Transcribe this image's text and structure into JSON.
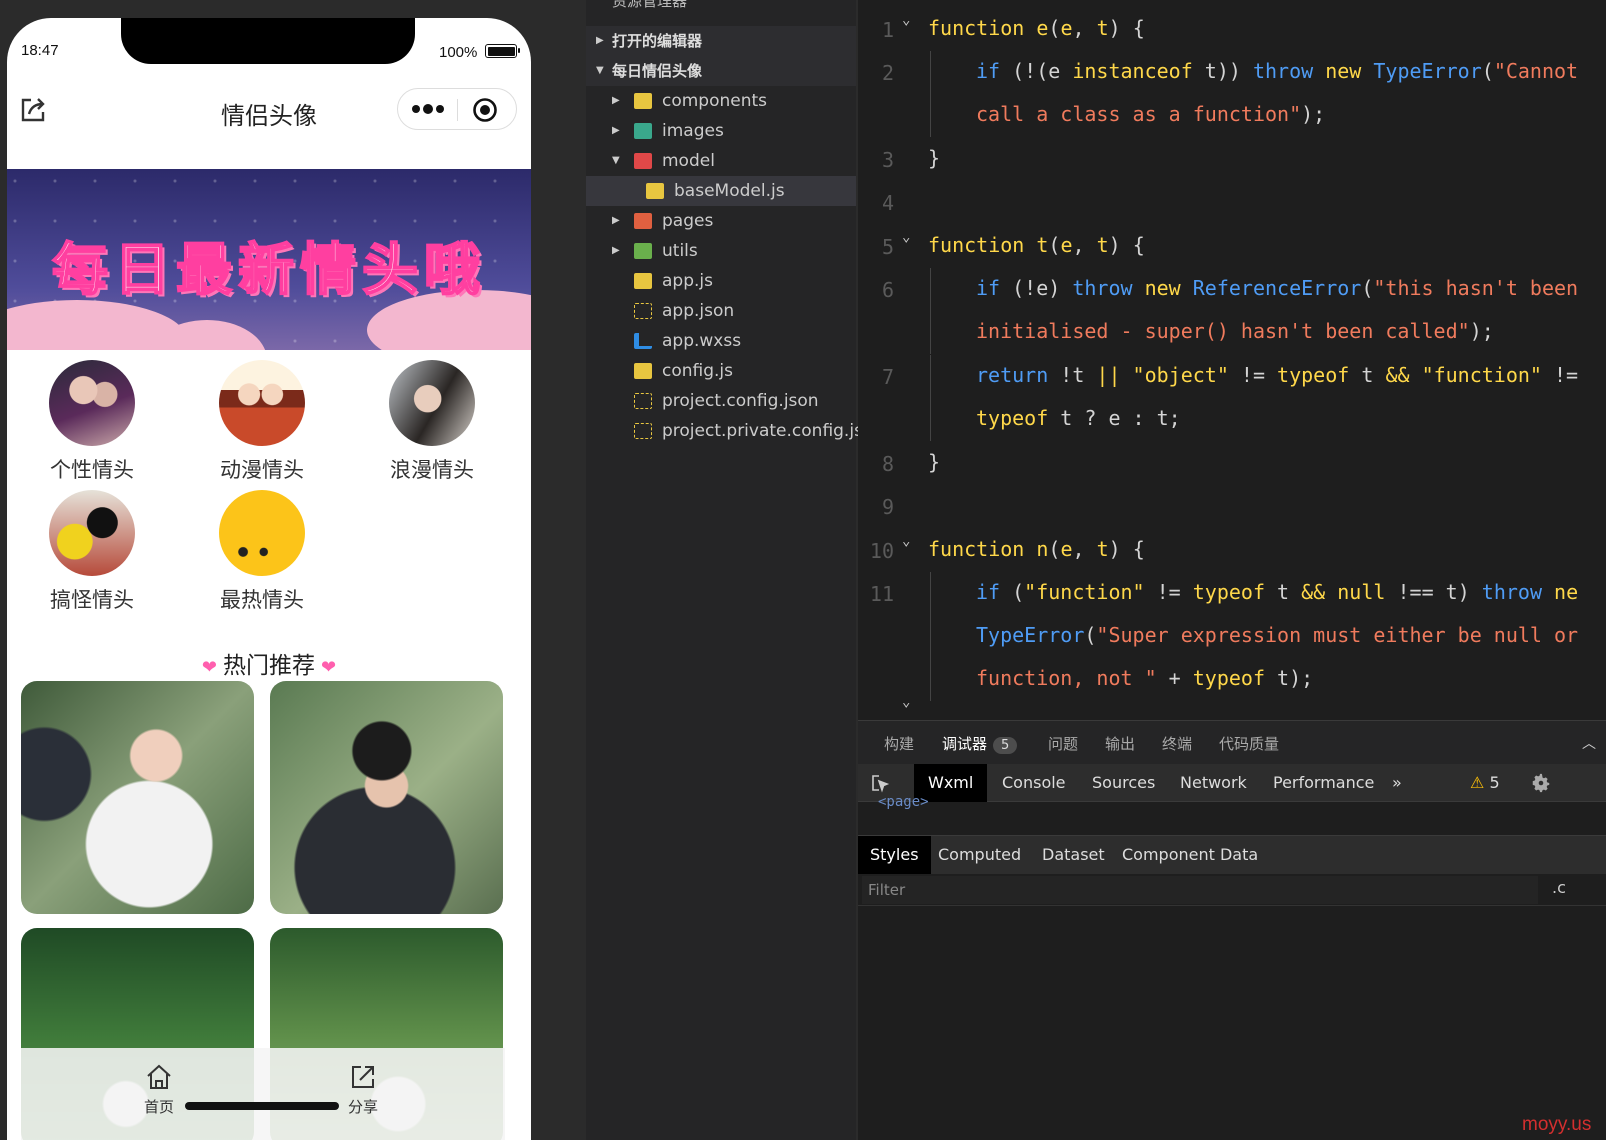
{
  "phone": {
    "status": {
      "time": "18:47",
      "battery": "100%",
      "battery_level": 1.0
    },
    "nav": {
      "title": "情侣头像"
    },
    "banner": {
      "text": "每日最新情头哦"
    },
    "categories": [
      {
        "label": "个性情头",
        "icon": "avatar-image"
      },
      {
        "label": "动漫情头",
        "icon": "avatar-image"
      },
      {
        "label": "浪漫情头",
        "icon": "avatar-image"
      },
      {
        "label": "搞怪情头",
        "icon": "avatar-image"
      },
      {
        "label": "最热情头",
        "icon": "avatar-image"
      }
    ],
    "hot_title": "热门推荐",
    "tabbar": [
      {
        "label": "首页",
        "icon": "home-icon"
      },
      {
        "label": "分享",
        "icon": "share-icon"
      }
    ]
  },
  "explorer": {
    "title": "资源管理器",
    "more": "···",
    "open_editors": "打开的编辑器",
    "project": "每日情侣头像",
    "items": [
      {
        "name": "components",
        "type": "folder",
        "color": "#e8c640"
      },
      {
        "name": "images",
        "type": "folder",
        "color": "#3aa88c"
      },
      {
        "name": "model",
        "type": "folder",
        "color": "#e04848"
      },
      {
        "name": "baseModel.js",
        "type": "js",
        "color": "#e8c640"
      },
      {
        "name": "pages",
        "type": "folder",
        "color": "#e06040"
      },
      {
        "name": "utils",
        "type": "folder",
        "color": "#6ab04c"
      },
      {
        "name": "app.js",
        "type": "js",
        "color": "#e8c640"
      },
      {
        "name": "app.json",
        "type": "json",
        "color": "#e8c640"
      },
      {
        "name": "app.wxss",
        "type": "css",
        "color": "#2f8de4"
      },
      {
        "name": "config.js",
        "type": "js",
        "color": "#e8c640"
      },
      {
        "name": "project.config.json",
        "type": "json",
        "color": "#e8c640"
      },
      {
        "name": "project.private.config.js...",
        "type": "json",
        "color": "#e8c640"
      }
    ]
  },
  "editor": {
    "lines": [
      {
        "n": "1",
        "fold": true,
        "indent": 0,
        "segs": [
          [
            "f",
            "function "
          ],
          [
            "y",
            "e"
          ],
          [
            "d",
            "("
          ],
          [
            "f",
            "e"
          ],
          [
            "d",
            ", "
          ],
          [
            "f",
            "t"
          ],
          [
            "d",
            ") {"
          ]
        ]
      },
      {
        "n": "2",
        "indent": 1,
        "segs": [
          [
            "k",
            "if "
          ],
          [
            "d",
            "(!("
          ],
          [
            "d",
            "e "
          ],
          [
            "f",
            "instanceof "
          ],
          [
            "d",
            "t)) "
          ],
          [
            "k",
            "throw "
          ],
          [
            "f",
            "new "
          ],
          [
            "k",
            "TypeError"
          ],
          [
            "d",
            "("
          ],
          [
            "s",
            "\"Cannot"
          ]
        ]
      },
      {
        "n": "",
        "indent": 1,
        "segs": [
          [
            "s",
            "call a class as a function"
          ],
          [
            "s",
            "\""
          ],
          [
            "d",
            ");"
          ]
        ]
      },
      {
        "n": "3",
        "indent": 0,
        "segs": [
          [
            "d",
            "}"
          ]
        ]
      },
      {
        "n": "4",
        "indent": 0,
        "segs": []
      },
      {
        "n": "5",
        "fold": true,
        "indent": 0,
        "segs": [
          [
            "f",
            "function "
          ],
          [
            "y",
            "t"
          ],
          [
            "d",
            "("
          ],
          [
            "f",
            "e"
          ],
          [
            "d",
            ", "
          ],
          [
            "f",
            "t"
          ],
          [
            "d",
            ") {"
          ]
        ]
      },
      {
        "n": "6",
        "indent": 1,
        "segs": [
          [
            "k",
            "if "
          ],
          [
            "d",
            "(!e) "
          ],
          [
            "k",
            "throw "
          ],
          [
            "f",
            "new "
          ],
          [
            "k",
            "ReferenceError"
          ],
          [
            "d",
            "("
          ],
          [
            "s",
            "\"this hasn't been"
          ]
        ]
      },
      {
        "n": "",
        "indent": 1,
        "segs": [
          [
            "s",
            "initialised - super() hasn't been called\""
          ],
          [
            "d",
            ");"
          ]
        ]
      },
      {
        "n": "7",
        "indent": 1,
        "segs": [
          [
            "k",
            "return "
          ],
          [
            "d",
            "!t "
          ],
          [
            "y",
            "|| "
          ],
          [
            "f",
            "\"object\" "
          ],
          [
            "d",
            "!= "
          ],
          [
            "f",
            "typeof "
          ],
          [
            "d",
            "t "
          ],
          [
            "y",
            "&& "
          ],
          [
            "f",
            "\"function\" "
          ],
          [
            "d",
            "!="
          ]
        ]
      },
      {
        "n": "",
        "indent": 1,
        "segs": [
          [
            "f",
            "typeof "
          ],
          [
            "d",
            "t ? e : t;"
          ]
        ]
      },
      {
        "n": "8",
        "indent": 0,
        "segs": [
          [
            "d",
            "}"
          ]
        ]
      },
      {
        "n": "9",
        "indent": 0,
        "segs": []
      },
      {
        "n": "10",
        "fold": true,
        "indent": 0,
        "segs": [
          [
            "f",
            "function "
          ],
          [
            "y",
            "n"
          ],
          [
            "d",
            "("
          ],
          [
            "f",
            "e"
          ],
          [
            "d",
            ", "
          ],
          [
            "f",
            "t"
          ],
          [
            "d",
            ") {"
          ]
        ]
      },
      {
        "n": "11",
        "indent": 1,
        "segs": [
          [
            "k",
            "if "
          ],
          [
            "d",
            "("
          ],
          [
            "f",
            "\"function\" "
          ],
          [
            "d",
            "!= "
          ],
          [
            "f",
            "typeof "
          ],
          [
            "d",
            "t "
          ],
          [
            "y",
            "&& "
          ],
          [
            "f",
            "null "
          ],
          [
            "d",
            "!== t) "
          ],
          [
            "k",
            "throw "
          ],
          [
            "f",
            "ne"
          ]
        ]
      },
      {
        "n": "",
        "indent": 1,
        "segs": [
          [
            "k",
            "TypeError"
          ],
          [
            "d",
            "("
          ],
          [
            "s",
            "\"Super expression must either be null or"
          ]
        ]
      },
      {
        "n": "",
        "indent": 1,
        "segs": [
          [
            "s",
            "function, not \" "
          ],
          [
            "d",
            "+ "
          ],
          [
            "f",
            "typeof "
          ],
          [
            "d",
            "t);"
          ]
        ]
      },
      {
        "n": "",
        "fold": true,
        "indent": 0,
        "segs": []
      }
    ]
  },
  "debugger": {
    "panel_tabs": [
      "构建",
      "调试器",
      "问题",
      "输出",
      "终端",
      "代码质量"
    ],
    "debugger_badge": "5",
    "devtools_tabs": [
      "Wxml",
      "Console",
      "Sources",
      "Network",
      "Performance"
    ],
    "more_tabs": "»",
    "warn_count": "5",
    "wxml_peek": "<page>",
    "styles_tabs": [
      "Styles",
      "Computed",
      "Dataset",
      "Component Data"
    ],
    "filter_placeholder": "Filter",
    "filter_right": ".c"
  },
  "watermark": "moyy.us"
}
